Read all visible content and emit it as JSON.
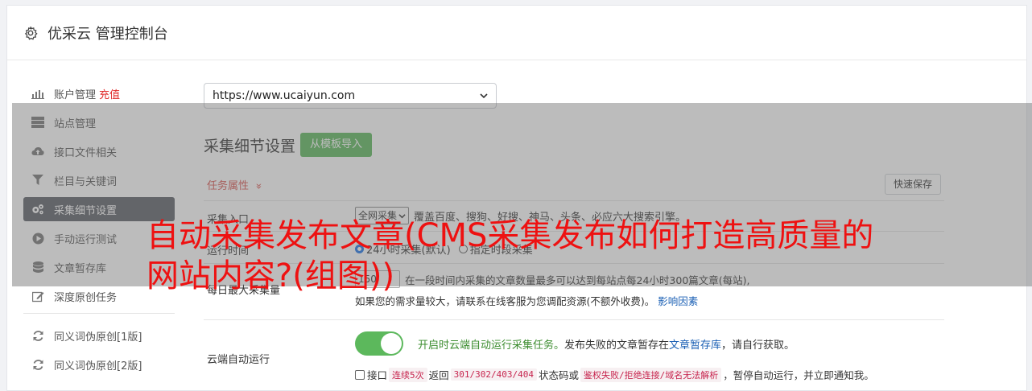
{
  "header": {
    "title": "优采云 管理控制台",
    "icon": "gear-icon"
  },
  "sidebar": {
    "items": [
      {
        "label": "账户管理",
        "extra": "充值",
        "icon": "bar-chart-icon"
      },
      {
        "label": "站点管理",
        "icon": "server-icon"
      },
      {
        "label": "接口文件相关",
        "icon": "cloud-upload-icon"
      },
      {
        "label": "栏目与关键词",
        "icon": "filter-icon"
      },
      {
        "label": "采集细节设置",
        "icon": "gears-icon",
        "active": true
      },
      {
        "label": "手动运行测试",
        "icon": "play-circle-icon"
      },
      {
        "label": "文章暂存库",
        "icon": "database-icon"
      },
      {
        "label": "深度原创任务",
        "icon": "edit-icon"
      },
      {
        "label": "同义词伪原创[1版]",
        "icon": "refresh-icon"
      },
      {
        "label": "同义词伪原创[2版]",
        "icon": "refresh-icon"
      }
    ]
  },
  "main": {
    "site_select": {
      "value": "https://www.ucaiyun.com"
    },
    "section_title": "采集细节设置",
    "import_button": "从模板导入",
    "task_attr_label": "任务属性",
    "task_attr_chevron": "»",
    "quick_save": "快速保存",
    "rows": {
      "entry": {
        "label": "采集入口",
        "select_value": "全网采集",
        "description": "覆盖百度、搜狗、好搜、神马、头条、必应六大搜索引擎。"
      },
      "time": {
        "label": "运行时间",
        "option1": "24小时采集(默认)",
        "option2": "指定时段采集"
      },
      "volume": {
        "label": "每日最大采集量",
        "value": "150",
        "description": "在一段时间内采集的文章数量最多可以达到每站点每24小时300篇文章(每站),",
        "note": "如果您的需求量较大，请联系在线客服为您调配资源(不额外收费)。",
        "factors_link": "影响因素"
      },
      "cloud": {
        "label": "云端自动运行",
        "toggle_on": true,
        "enable_text": "开启时云端自动运行采集任务。",
        "fail_text_1": "发布失败的文章暂存在",
        "fail_link": "文章暂存库",
        "fail_text_2": "，请自行获取。",
        "check_label": "接口",
        "code1": "连续5次",
        "text_return": "返回",
        "code2": "301/302/403/404",
        "text_status": "状态码或",
        "code3": "鉴权失败/拒绝连接/域名无法解析",
        "text_end": "，暂停自动运行，并立即通知我。"
      }
    }
  },
  "overlay_title": "自动采集发布文章(CMS采集发布如何打造高质量的网站内容?(组图))",
  "colors": {
    "accent_green": "#5cb85c",
    "active_nav": "#5c5f66",
    "title_red": "#ee1111"
  }
}
